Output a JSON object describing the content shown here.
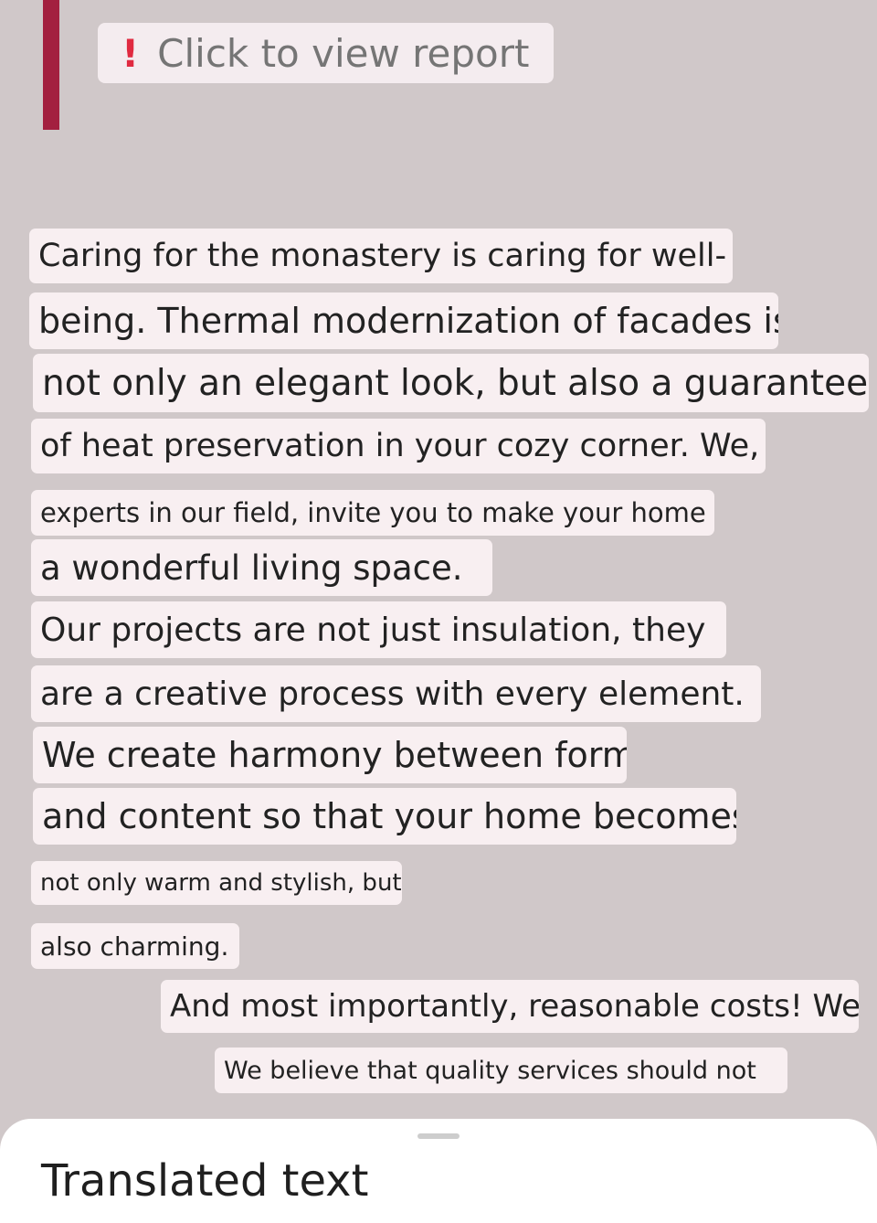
{
  "report_chip": {
    "icon": "!",
    "label": "Click to view report"
  },
  "translated_lines": [
    "Caring for the monastery is caring for well-",
    "being. Thermal modernization of facades is",
    "not only an elegant look, but also a guarantee",
    "of heat preservation in your cozy corner. We,",
    "experts in our field, invite you to make your home",
    "a wonderful living space.",
    "Our projects are not just insulation, they",
    "are a creative process with every element.",
    "We create harmony between form",
    "and content so that your home becomes",
    "not only warm and stylish, but",
    "also charming.",
    "And most importantly, reasonable costs! We",
    "We believe that quality services should not"
  ],
  "bottom_sheet": {
    "title": "Translated text"
  },
  "colors": {
    "background": "#d0c8c9",
    "accent_bar": "#a3203f",
    "overlay_box": "#f8eff1",
    "alert_icon": "#e02a40"
  }
}
